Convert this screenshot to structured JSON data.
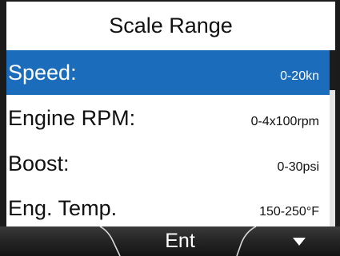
{
  "header": {
    "title": "Scale Range"
  },
  "list": {
    "items": [
      {
        "label": "Speed:",
        "value": "0-20kn",
        "selected": true
      },
      {
        "label": "Engine RPM:",
        "value": "0-4x100rpm",
        "selected": false
      },
      {
        "label": "Boost:",
        "value": "0-30psi",
        "selected": false
      },
      {
        "label": "Eng. Temp.",
        "value": "150-250°F",
        "selected": false
      }
    ]
  },
  "softkeys": {
    "left_label": "",
    "center_label": "Ent",
    "right_icon": "down-arrow-icon"
  },
  "colors": {
    "selection": "#1b6dbb",
    "softkey_bar": "#2a2a2a",
    "bezel": "#1b1b1b"
  }
}
